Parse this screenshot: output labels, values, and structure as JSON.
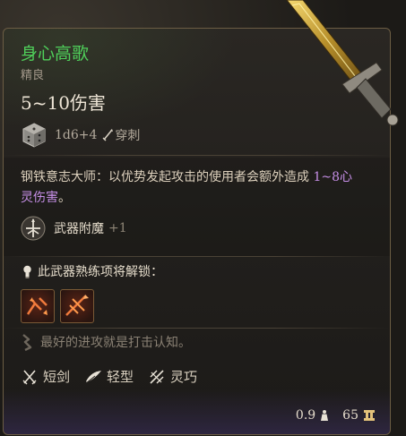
{
  "item": {
    "name": "身心高歌",
    "rarity": "精良",
    "damage": "5~10伤害",
    "dice_formula": "1d6+4",
    "damage_type": "穿刺"
  },
  "description": {
    "prefix": "钢铁意志大师：以优势发起攻击的使用者会额外造成 ",
    "highlight": "1~8心灵伤害",
    "suffix": "。"
  },
  "enchant": {
    "label": "武器附魔",
    "bonus": "+1"
  },
  "proficiency": {
    "title": "此武器熟练项将解锁：",
    "actions": [
      {
        "icon": "flourish-action-icon"
      },
      {
        "icon": "piercing-strike-action-icon"
      }
    ]
  },
  "flavor_text": "最好的进攻就是打击认知。",
  "properties": [
    {
      "icon": "short-sword-icon",
      "label": "短剑"
    },
    {
      "icon": "light-weapon-icon",
      "label": "轻型"
    },
    {
      "icon": "finesse-icon",
      "label": "灵巧"
    }
  ],
  "footer": {
    "weight": "0.9",
    "value": "65"
  },
  "colors": {
    "name": "#4fcf5a",
    "highlight": "#c58ee6",
    "border": "#6c5d44"
  }
}
